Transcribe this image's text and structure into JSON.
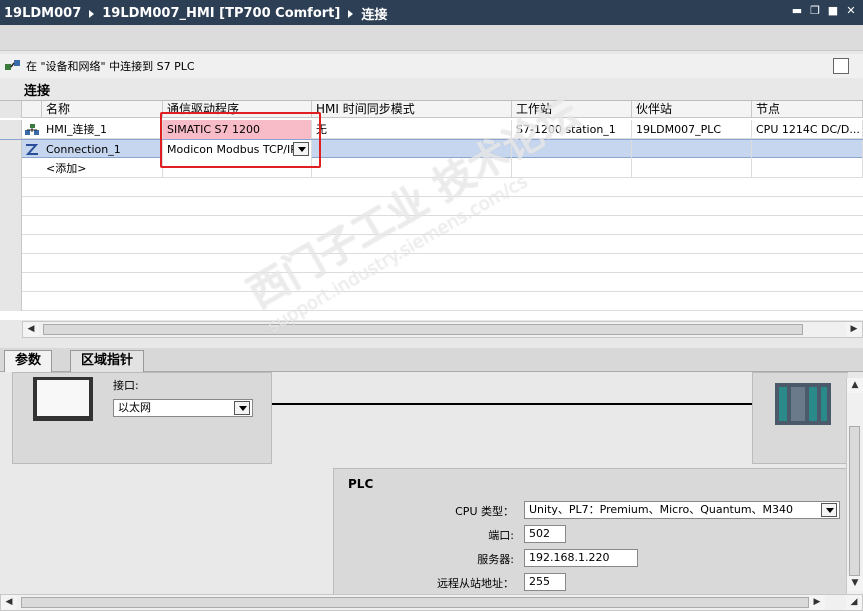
{
  "breadcrumb": [
    "19LDM007",
    "19LDM007_HMI [TP700 Comfort]",
    "连接"
  ],
  "info_text": "在 \"设备和网络\" 中连接到 S7 PLC",
  "section_title": "连接",
  "table": {
    "headers": [
      "名称",
      "通信驱动程序",
      "HMI 时间同步模式",
      "工作站",
      "伙伴站",
      "节点"
    ],
    "rows": [
      {
        "name": "HMI_连接_1",
        "driver": "SIMATIC S7 1200",
        "sync": "无",
        "station": "S7-1200 station_1",
        "partner": "19LDM007_PLC",
        "node": "CPU 1214C DC/D..."
      },
      {
        "name": "Connection_1",
        "driver": "Modicon Modbus TCP/IP",
        "sync": "",
        "station": "",
        "partner": "",
        "node": ""
      },
      {
        "name": "<添加>",
        "driver": "",
        "sync": "",
        "station": "",
        "partner": "",
        "node": ""
      }
    ]
  },
  "tabs": [
    "参数",
    "区域指针"
  ],
  "hmi_panel": {
    "interface_label": "接口:",
    "interface_value": "以太网"
  },
  "plc_panel": {
    "title": "PLC",
    "cpu_type_label": "CPU 类型：",
    "cpu_type_value": "Unity、PL7：Premium、Micro、Quantum、M340",
    "port_label": "端口:",
    "port_value": "502",
    "server_label": "服务器:",
    "server_value": "192.168.1.220",
    "remote_label": "远程从站地址：",
    "remote_value": "255"
  },
  "watermark": "西门子工业  技术论坛",
  "watermark_url": "support.industry.siemens.com/cs",
  "colors": {
    "titlebar": "#2d3f55",
    "highlight_pink": "#f8bcc8",
    "selection": "#c6d6ef",
    "annotation_red": "#e02020"
  }
}
